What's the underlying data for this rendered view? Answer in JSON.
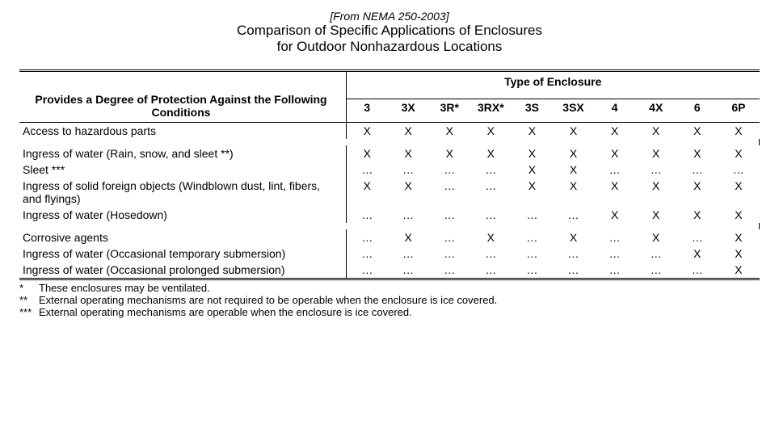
{
  "header": {
    "source": "[From NEMA 250-2003]",
    "title": "Comparison of Specific Applications of Enclosures",
    "subtitle": "for Outdoor Nonhazardous Locations"
  },
  "table": {
    "row_header_label": "Provides a Degree of Protection Against the Following Conditions",
    "type_header": "Type of Enclosure",
    "columns": [
      "3",
      "3X",
      "3R*",
      "3RX*",
      "3S",
      "3SX",
      "4",
      "4X",
      "6",
      "6P"
    ],
    "rows": [
      {
        "label": "Access to hazardous parts",
        "values": [
          "X",
          "X",
          "X",
          "X",
          "X",
          "X",
          "X",
          "X",
          "X",
          "X"
        ]
      },
      {
        "label": "Ingress of water (Rain, snow, and sleet **)",
        "values": [
          "X",
          "X",
          "X",
          "X",
          "X",
          "X",
          "X",
          "X",
          "X",
          "X"
        ]
      },
      {
        "label": "Sleet ***",
        "values": [
          "…",
          "…",
          "…",
          "…",
          "X",
          "X",
          "…",
          "…",
          "…",
          "…"
        ]
      },
      {
        "label": "Ingress of solid foreign objects (Windblown dust, lint, fibers, and flyings)",
        "values": [
          "X",
          "X",
          "…",
          "…",
          "X",
          "X",
          "X",
          "X",
          "X",
          "X"
        ]
      },
      {
        "label": "Ingress of water (Hosedown)",
        "values": [
          "…",
          "…",
          "…",
          "…",
          "…",
          "…",
          "X",
          "X",
          "X",
          "X"
        ]
      },
      {
        "label": "Corrosive agents",
        "values": [
          "…",
          "X",
          "…",
          "X",
          "…",
          "X",
          "…",
          "X",
          "…",
          "X"
        ]
      },
      {
        "label": "Ingress of water (Occasional temporary submersion)",
        "values": [
          "…",
          "…",
          "…",
          "…",
          "…",
          "…",
          "…",
          "…",
          "X",
          "X"
        ]
      },
      {
        "label": "Ingress of water (Occasional prolonged submersion)",
        "values": [
          "…",
          "…",
          "…",
          "…",
          "…",
          "…",
          "…",
          "…",
          "…",
          "X"
        ]
      }
    ]
  },
  "footnotes": [
    {
      "mark": "*",
      "text": "These enclosures may be ventilated."
    },
    {
      "mark": "**",
      "text": "External operating mechanisms are not required to be operable when the enclosure is ice covered."
    },
    {
      "mark": "***",
      "text": "External operating mechanisms are operable when the enclosure is ice covered."
    }
  ]
}
